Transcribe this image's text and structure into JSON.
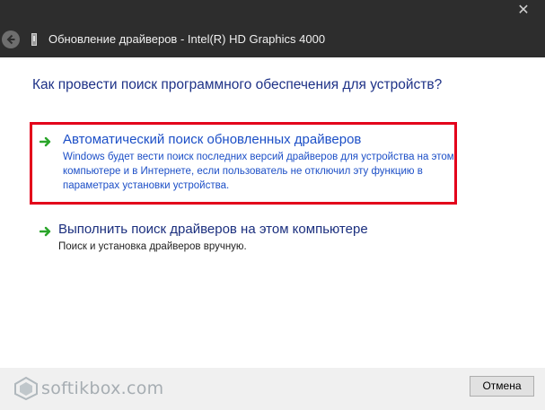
{
  "window": {
    "title": "Обновление драйверов - Intel(R) HD Graphics 4000",
    "close_glyph": "✕"
  },
  "main": {
    "question": "Как провести поиск программного обеспечения для устройств?",
    "options": [
      {
        "title": "Автоматический поиск обновленных драйверов",
        "description": "Windows будет вести поиск последних версий драйверов для устройства на этом компьютере и в Интернете, если пользователь не отключил эту функцию в параметрах установки устройства.",
        "icon": "green-arrow-icon",
        "highlight_color": "#e3001b"
      },
      {
        "title": "Выполнить поиск драйверов на этом компьютере",
        "description": "Поиск и установка драйверов вручную.",
        "icon": "green-arrow-icon"
      }
    ]
  },
  "footer": {
    "cancel_label": "Отмена"
  },
  "watermark": {
    "text": "softikbox.com"
  },
  "colors": {
    "titlebar": "#2d2d2d",
    "link_blue": "#1c4fc7",
    "heading_blue": "#1e3287",
    "arrow_green": "#2aa52a"
  }
}
